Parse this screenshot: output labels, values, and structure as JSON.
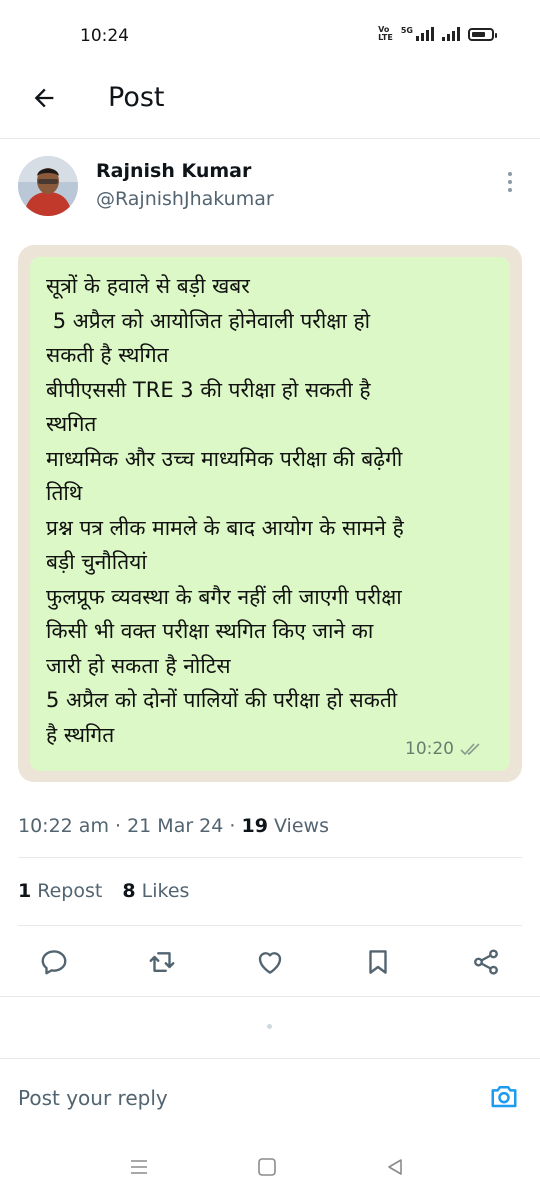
{
  "status_bar": {
    "time": "10:24",
    "indicators": [
      "VoLTE",
      "5G",
      "signal-1",
      "signal-2",
      "battery"
    ]
  },
  "header": {
    "title": "Post",
    "back_icon": "arrow-left-icon"
  },
  "post": {
    "author": {
      "name": "Rajnish Kumar",
      "handle": "@RajnishJhakumar",
      "avatar": "avatar-photo"
    },
    "media": {
      "kind": "whatsapp-message-screenshot",
      "message_text": "सूत्रों के हवाले से बड़ी खबर\n 5 अप्रैल को आयोजित होनेवाली परीक्षा हो\nसकती है स्थगित\nबीपीएससी TRE 3 की परीक्षा हो सकती है\nस्थगित\nमाध्यमिक और उच्च माध्यमिक परीक्षा की बढ़ेगी\nतिथि\nप्रश्न पत्र लीक मामले के बाद आयोग के सामने है\nबड़ी चुनौतियां\nफुलप्रूफ व्यवस्था के बगैर नहीं ली जाएगी परीक्षा\nकिसी भी वक्त परीक्षा स्थगित किए जाने का\nजारी हो सकता है नोटिस\n5 अप्रैल को दोनों पालियों की परीक्षा हो सकती\nहै स्थगित",
      "message_time": "10:20",
      "bubble_color": "#dcf8c6",
      "chat_background": "#ede4d8"
    },
    "meta": {
      "time": "10:22 am",
      "sep": " · ",
      "date": "21 Mar 24",
      "views_count": "19",
      "views_label": " Views"
    },
    "stats": {
      "reposts_count": "1",
      "reposts_label": " Repost",
      "likes_count": "8",
      "likes_label": " Likes"
    },
    "actions": [
      "reply-icon",
      "repost-icon",
      "like-icon",
      "bookmark-icon",
      "share-icon"
    ]
  },
  "reply": {
    "placeholder": "Post your reply",
    "camera_icon": "camera-icon"
  },
  "nav_bar": [
    "menu-icon",
    "home-square-icon",
    "back-triangle-icon"
  ],
  "colors": {
    "text_primary": "#0f1419",
    "text_secondary": "#536471",
    "accent": "#1d9bf0",
    "divider": "#e6e9ec"
  }
}
